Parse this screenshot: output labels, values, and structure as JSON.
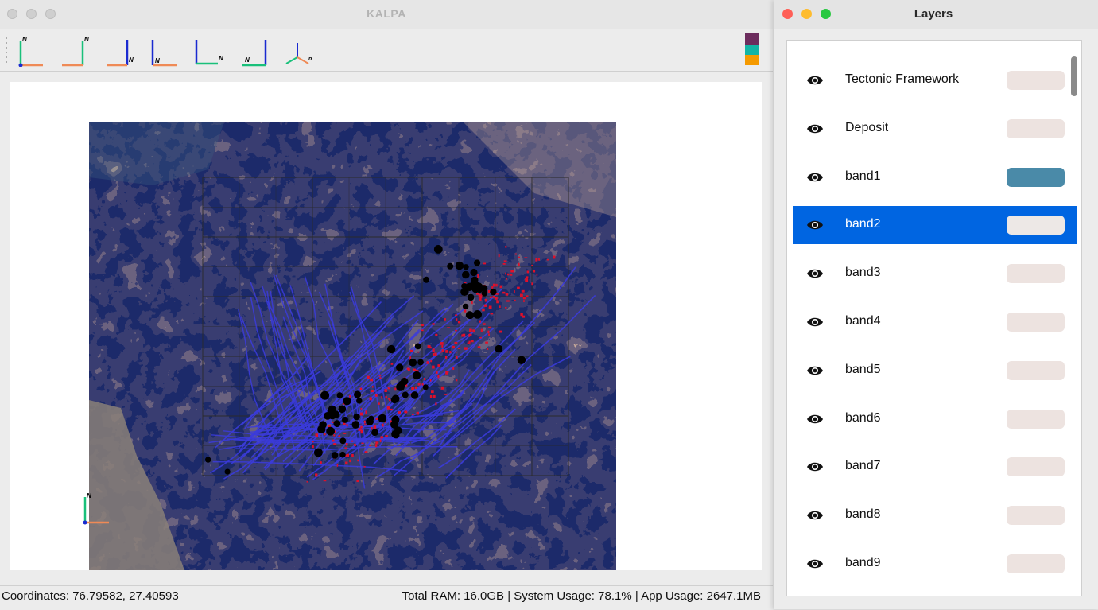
{
  "main_window": {
    "title": "KALPA"
  },
  "toolbar": {
    "view_buttons": [
      {
        "icon": "axis-view-1-icon"
      },
      {
        "icon": "axis-view-2-icon"
      },
      {
        "icon": "axis-view-3-icon"
      },
      {
        "icon": "axis-view-4-icon"
      },
      {
        "icon": "axis-view-5-icon"
      },
      {
        "icon": "axis-view-6-icon"
      },
      {
        "icon": "axis-view-3d-icon"
      }
    ],
    "axis_label": "N",
    "axis_label_small": "n",
    "color_swatches": [
      "#6d2d5e",
      "#13b5a5",
      "#f59a00"
    ]
  },
  "map": {
    "orientation_axis_label": "N",
    "legend": {
      "fault_line_color": "#3b3bdc",
      "deposit_color": "#000000",
      "anomaly_color": "#e0102a"
    }
  },
  "status_bar": {
    "coordinates": "Coordinates: 76.79582, 27.40593",
    "usage": "Total RAM: 16.0GB | System Usage: 78.1% | App Usage: 2647.1MB"
  },
  "layers_window": {
    "title": "Layers",
    "items": [
      {
        "name": "Tectonic Framework",
        "swatch": "#ede3e0",
        "selected": false
      },
      {
        "name": "Deposit",
        "swatch": "#ede3e0",
        "selected": false
      },
      {
        "name": "band1",
        "swatch": "#4a8aa8",
        "selected": false
      },
      {
        "name": "band2",
        "swatch": "#ede3e0",
        "selected": true
      },
      {
        "name": "band3",
        "swatch": "#ede3e0",
        "selected": false
      },
      {
        "name": "band4",
        "swatch": "#ede3e0",
        "selected": false
      },
      {
        "name": "band5",
        "swatch": "#ede3e0",
        "selected": false
      },
      {
        "name": "band6",
        "swatch": "#ede3e0",
        "selected": false
      },
      {
        "name": "band7",
        "swatch": "#ede3e0",
        "selected": false
      },
      {
        "name": "band8",
        "swatch": "#ede3e0",
        "selected": false
      },
      {
        "name": "band9",
        "swatch": "#ede3e0",
        "selected": false
      }
    ]
  },
  "colors": {
    "selection_accent": "#0065e1",
    "close_light": "#ff5f57",
    "minimize_light": "#febc2e",
    "zoom_light": "#28c840"
  }
}
